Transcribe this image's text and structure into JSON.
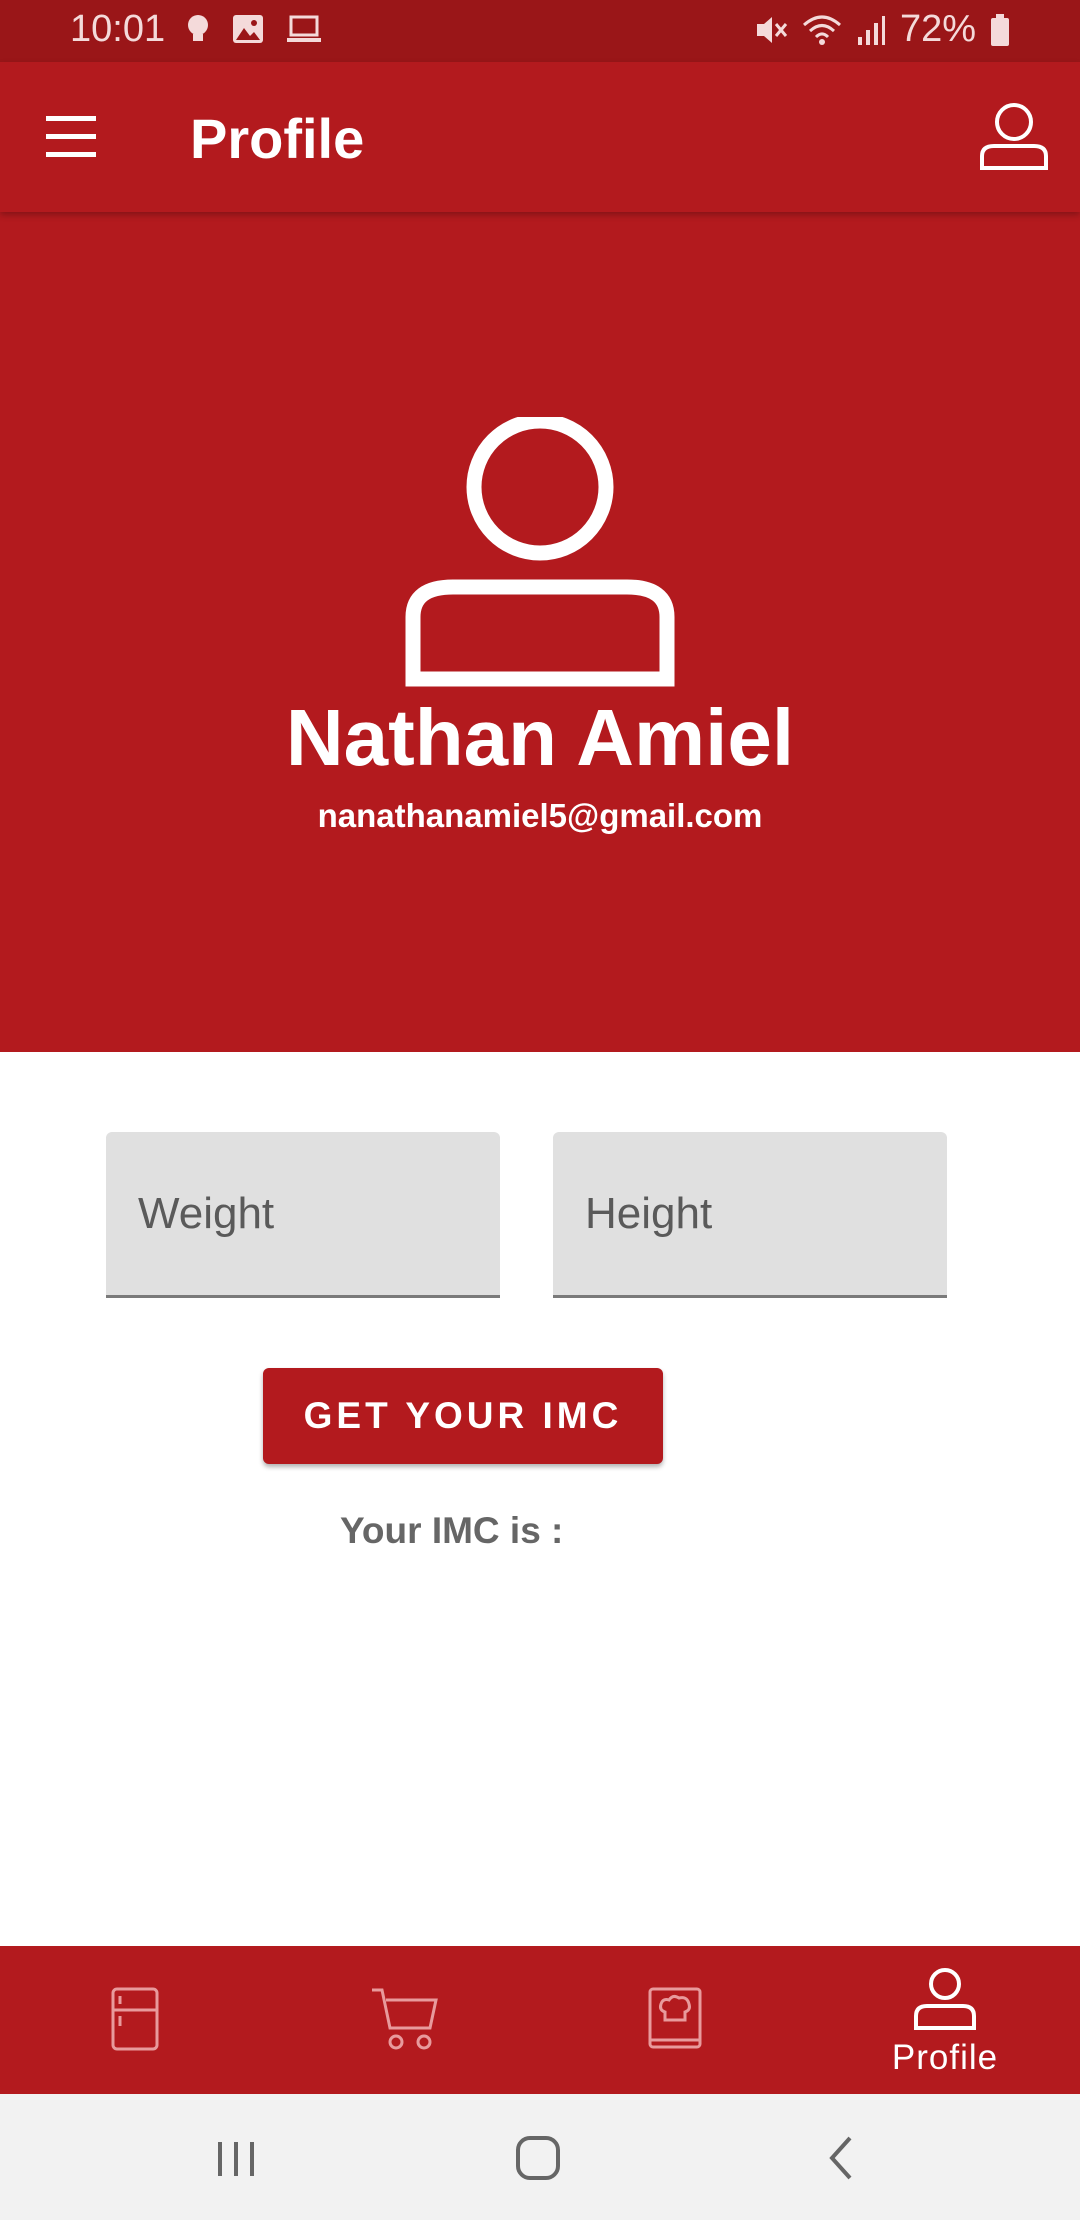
{
  "status_bar": {
    "time": "10:01",
    "battery": "72%",
    "icons": [
      "lightbulb-icon",
      "image-icon",
      "laptop-icon",
      "mute-icon",
      "wifi-icon",
      "signal-icon",
      "battery-icon"
    ]
  },
  "app_bar": {
    "title": "Profile",
    "menu_icon": "menu-icon",
    "account_icon": "account-icon"
  },
  "profile": {
    "name": "Nathan Amiel",
    "email": "nanathanamiel5@gmail.com"
  },
  "form": {
    "weight_placeholder": "Weight",
    "height_placeholder": "Height",
    "button_label": "GET YOUR IMC",
    "result_label": "Your IMC is :"
  },
  "bottom_nav": {
    "items": [
      {
        "icon": "fridge-icon",
        "label": ""
      },
      {
        "icon": "cart-icon",
        "label": ""
      },
      {
        "icon": "recipe-book-icon",
        "label": ""
      },
      {
        "icon": "profile-icon",
        "label": "Profile",
        "active": true
      }
    ]
  },
  "system_nav": [
    "recents-button",
    "home-button",
    "back-button"
  ],
  "colors": {
    "primary": "#b31a1e",
    "status_bar": "#9a1618",
    "field_bg": "#e0e0e0",
    "system_nav_bg": "#f2f2f2"
  }
}
